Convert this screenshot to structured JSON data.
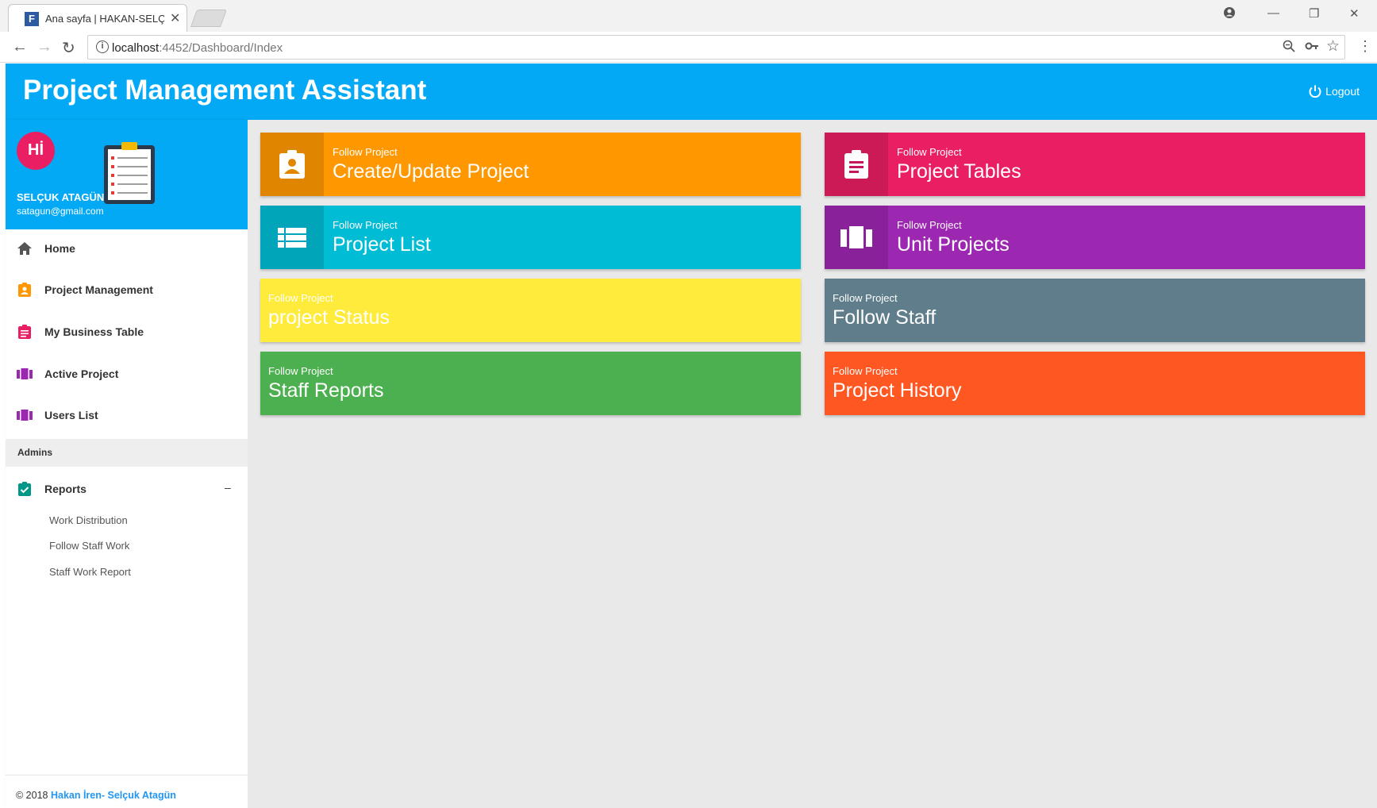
{
  "browser": {
    "tab_title": "Ana sayfa | HAKAN-SELÇ",
    "url_host": "localhost",
    "url_path": ":4452/Dashboard/Index"
  },
  "app": {
    "title": "Project Management Assistant",
    "logout_label": "Logout",
    "accent_color": "#03a9f4"
  },
  "user": {
    "avatar_text": "Hİ",
    "name": "SELÇUK ATAGÜN",
    "email": "satagun@gmail.com"
  },
  "sidebar": {
    "items": [
      {
        "label": "Home",
        "icon": "home-icon",
        "color": "#555555"
      },
      {
        "label": "Project Management",
        "icon": "contact-card-icon",
        "color": "#ff9800"
      },
      {
        "label": "My Business Table",
        "icon": "assignment-icon",
        "color": "#e91e63"
      },
      {
        "label": "Active Project",
        "icon": "view-array-icon",
        "color": "#9c27b0"
      },
      {
        "label": "Users List",
        "icon": "view-array-icon",
        "color": "#9c27b0"
      }
    ],
    "admins_header": "Admins",
    "reports": {
      "label": "Reports",
      "collapse_symbol": "–",
      "icon": "assignment-turned-in-icon",
      "color": "#009688",
      "subitems": [
        "Work Distribution",
        "Follow Staff Work",
        "Staff Work Report"
      ]
    },
    "footer": {
      "prefix": "© 2018 ",
      "authors": "Hakan İren- Selçuk Atagün"
    }
  },
  "dashboard": {
    "cards": [
      {
        "sub": "Follow Project",
        "title": "Create/Update Project",
        "color": "#ff9800",
        "icon": "contact-card-icon"
      },
      {
        "sub": "Follow Project",
        "title": "Project Tables",
        "color": "#e91e63",
        "icon": "assignment-icon"
      },
      {
        "sub": "Follow Project",
        "title": "Project List",
        "color": "#00bcd4",
        "icon": "list-icon"
      },
      {
        "sub": "Follow Project",
        "title": "Unit Projects",
        "color": "#9c27b0",
        "icon": "view-array-icon"
      },
      {
        "sub": "Follow Project",
        "title": "project Status",
        "color": "#ffeb3b"
      },
      {
        "sub": "Follow Project",
        "title": "Follow Staff",
        "color": "#607d8b"
      },
      {
        "sub": "Follow Project",
        "title": "Staff Reports",
        "color": "#4caf50"
      },
      {
        "sub": "Follow Project",
        "title": "Project History",
        "color": "#ff5722"
      }
    ]
  }
}
